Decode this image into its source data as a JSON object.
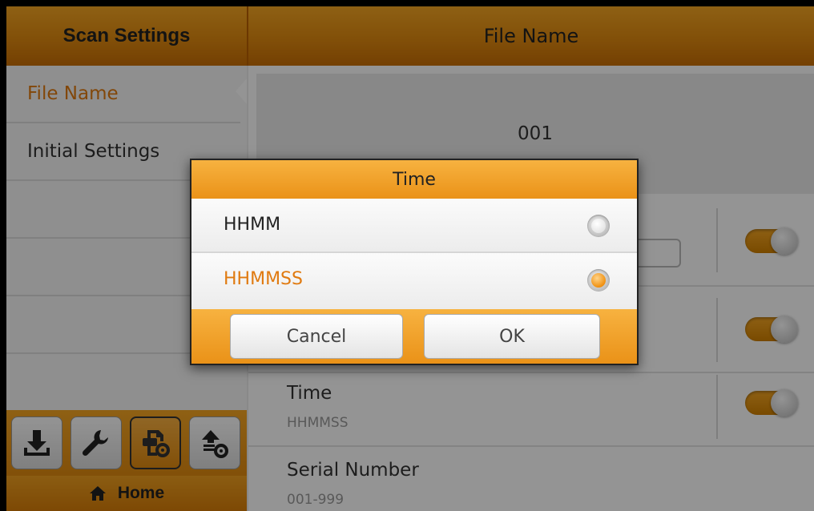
{
  "header": {
    "left_title": "Scan Settings",
    "right_title": "File Name"
  },
  "sidebar": {
    "items": [
      {
        "label": "File Name",
        "active": true
      },
      {
        "label": "Initial Settings",
        "active": false
      },
      {
        "label": "",
        "active": false
      },
      {
        "label": "",
        "active": false
      },
      {
        "label": "",
        "active": false
      }
    ],
    "toolbar": [
      {
        "icon": "download-icon"
      },
      {
        "icon": "wrench-icon"
      },
      {
        "icon": "scan-settings-icon",
        "active": true
      },
      {
        "icon": "upload-settings-icon"
      }
    ],
    "home_label": "Home"
  },
  "main": {
    "preview_value": "001",
    "rows": [
      {
        "title": "",
        "subtitle": "",
        "toggle_on": true
      },
      {
        "title": "",
        "subtitle": "",
        "toggle_on": true
      },
      {
        "title": "Time",
        "subtitle": "HHMMSS",
        "toggle_on": true
      },
      {
        "title": "Serial Number",
        "subtitle": "001-999"
      }
    ]
  },
  "dialog": {
    "title": "Time",
    "options": [
      {
        "label": "HHMM",
        "selected": false
      },
      {
        "label": "HHMMSS",
        "selected": true
      }
    ],
    "cancel_label": "Cancel",
    "ok_label": "OK"
  },
  "colors": {
    "accent": "#f5a623",
    "selected_text": "#e07a10"
  }
}
